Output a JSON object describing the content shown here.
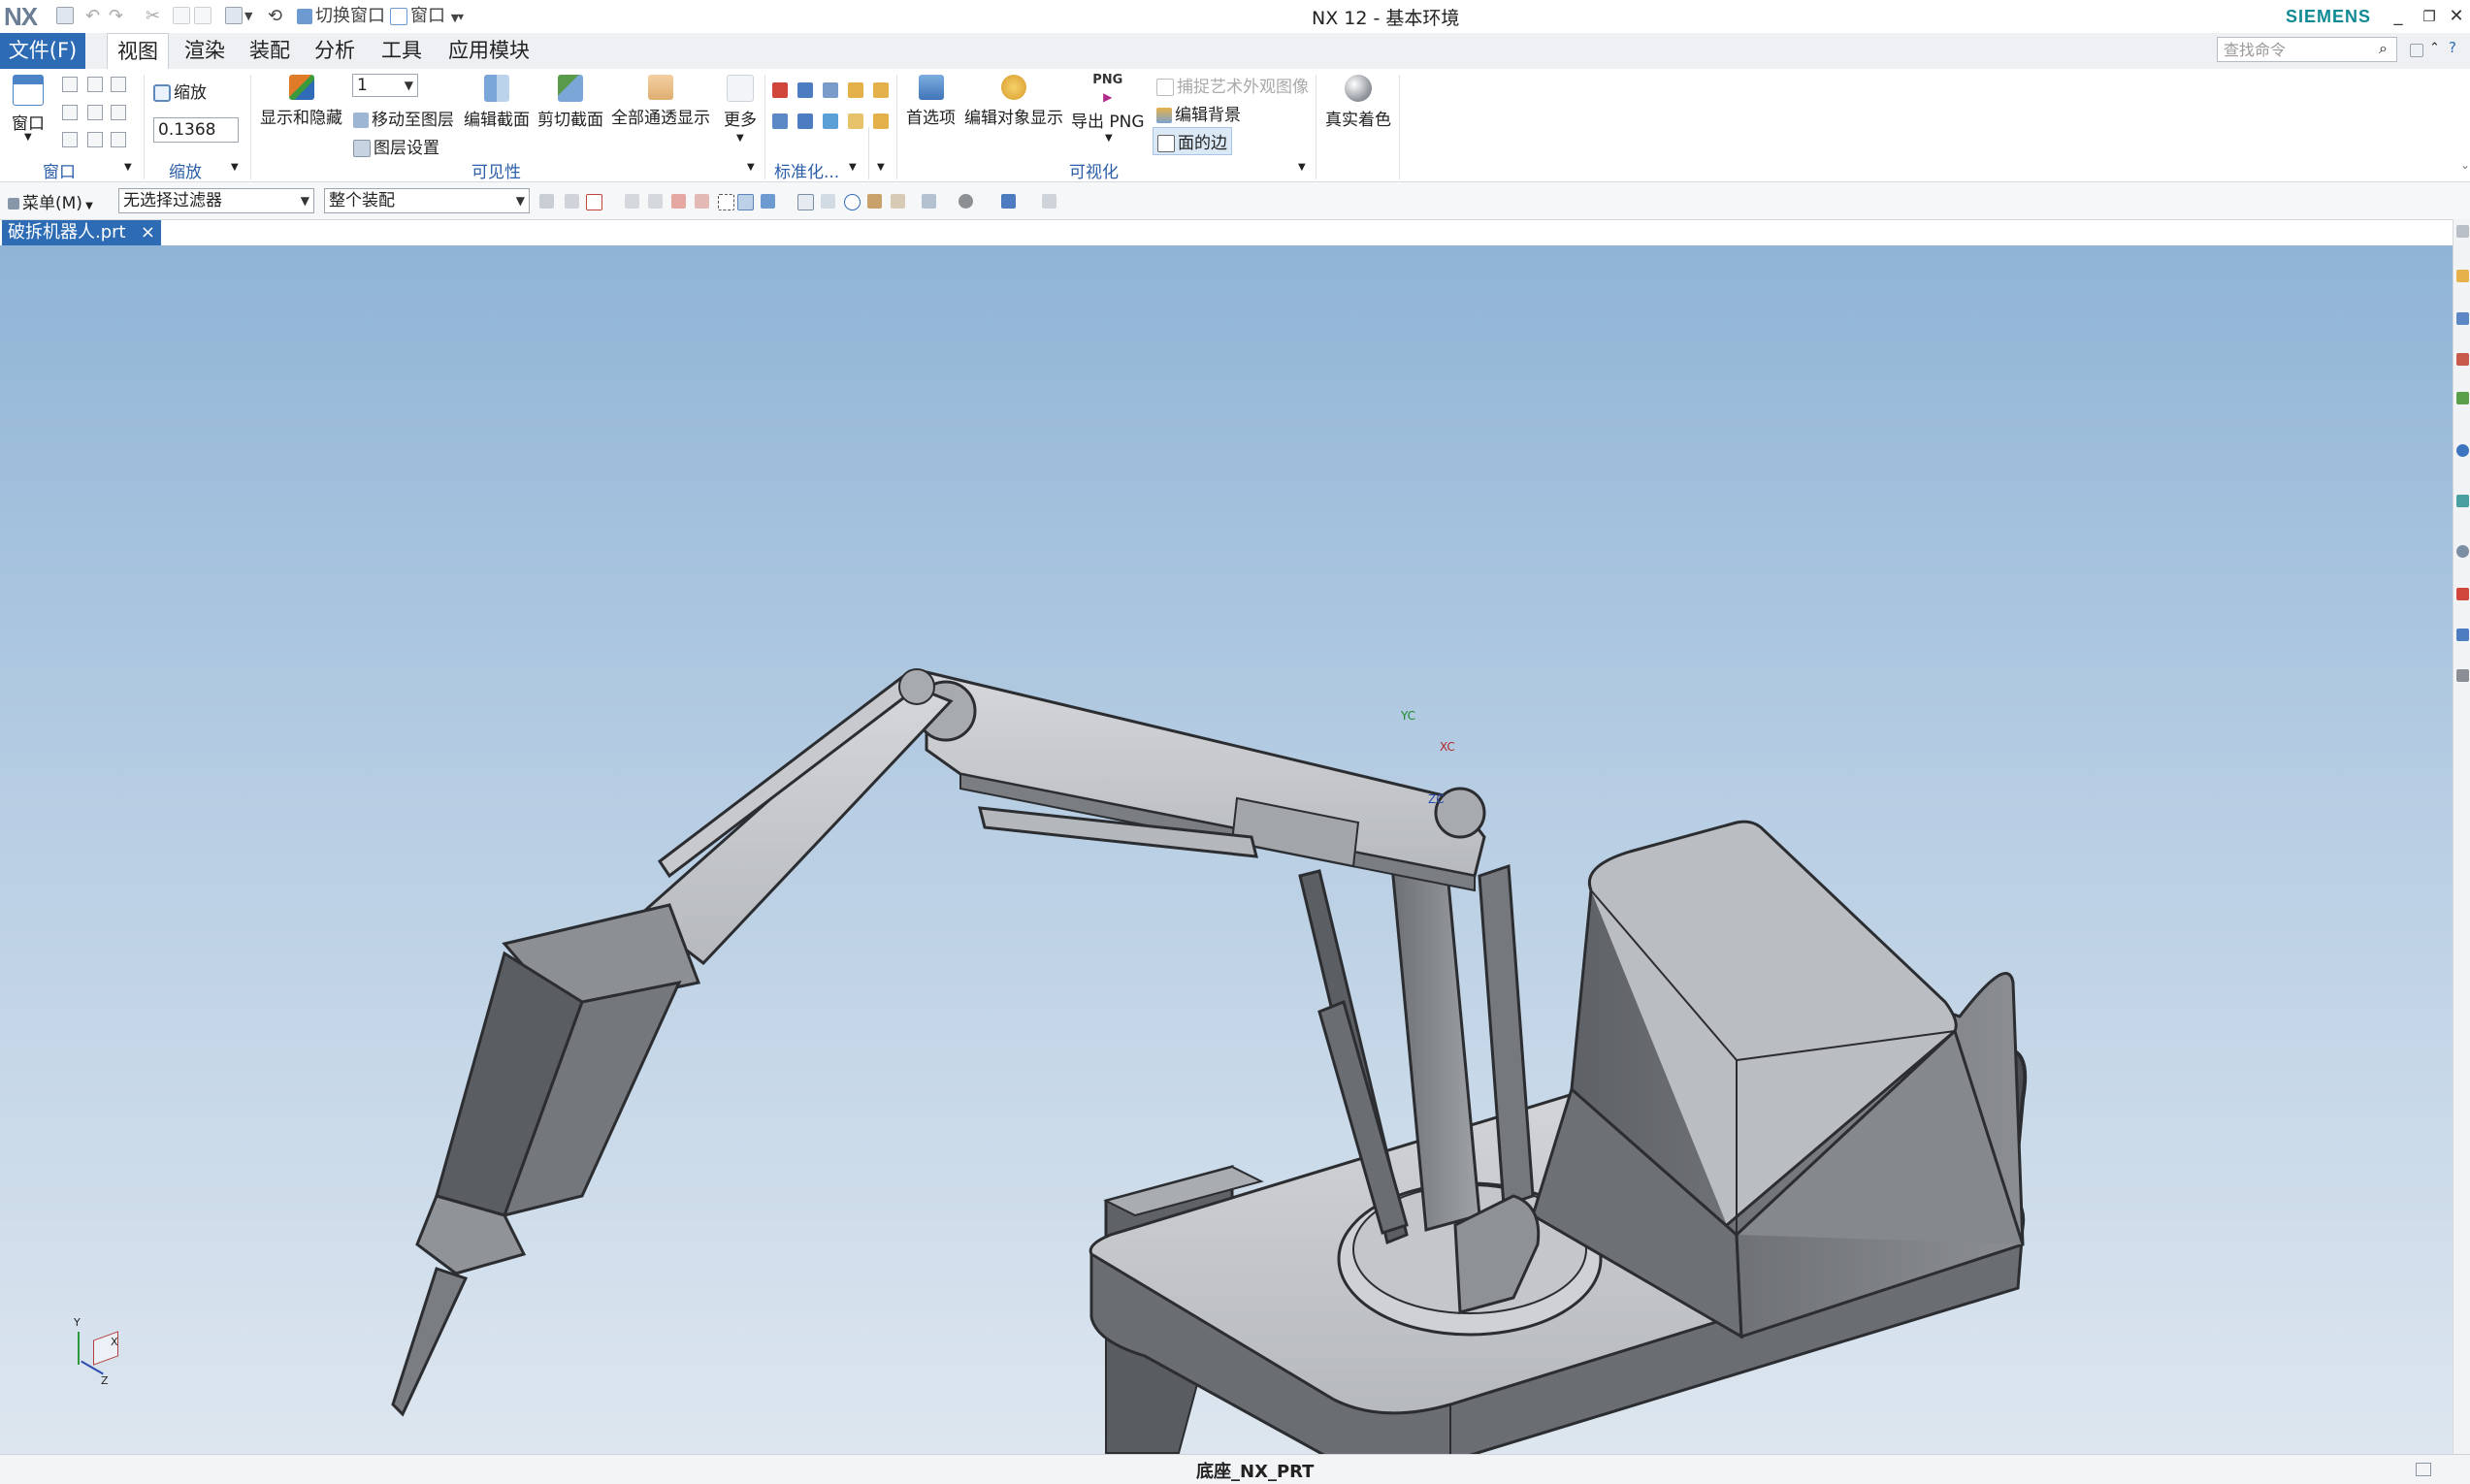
{
  "titlebar": {
    "logo": "NX",
    "quick_access": {
      "switch_window": "切换窗口",
      "window": "窗口"
    },
    "title": "NX 12 - 基本环境",
    "brand": "SIEMENS",
    "minimize": "_",
    "restore": "❐",
    "close": "✕"
  },
  "menubar": {
    "file": "文件(F)",
    "tabs": [
      "视图",
      "渲染",
      "装配",
      "分析",
      "工具",
      "应用模块"
    ],
    "active_tab": "视图",
    "search_placeholder": "查找命令"
  },
  "ribbon": {
    "window_group": {
      "button": "窗口",
      "label": "窗口"
    },
    "zoom_group": {
      "button": "缩放",
      "value": "0.1368",
      "label": "缩放"
    },
    "visibility_group": {
      "show_hide": "显示和隐藏",
      "layer_value": "1",
      "move_to_layer": "移动至图层",
      "layer_settings": "图层设置",
      "edit_section": "编辑截面",
      "clip_section": "剪切截面",
      "all_transparent": "全部通透显示",
      "more": "更多",
      "label": "可见性"
    },
    "standard_group": {
      "label": "标准化..."
    },
    "visualization_group": {
      "preferences": "首选项",
      "edit_object_display": "编辑对象显示",
      "export_png": "导出 PNG",
      "png_badge": "PNG",
      "capture_studio": "捕捉艺术外观图像",
      "edit_background": "编辑背景",
      "face_edges": "面的边",
      "label": "可视化"
    },
    "true_shading": "真实着色"
  },
  "toolbar": {
    "menu": "菜单(M)",
    "selection_filter": "无选择过滤器",
    "assembly_scope": "整个装配"
  },
  "document": {
    "tab": "破拆机器人.prt",
    "close": "×"
  },
  "viewport": {
    "wcs_labels": {
      "xc": "XC",
      "yc": "YC",
      "zc": "ZC"
    },
    "triad_labels": {
      "x": "X",
      "y": "Y",
      "z": "Z"
    }
  },
  "statusbar": {
    "text": "底座_NX_PRT"
  },
  "colors": {
    "file_tab": "#2d6cb5",
    "group_label": "#2b5ea8",
    "brand": "#0e8a94"
  }
}
